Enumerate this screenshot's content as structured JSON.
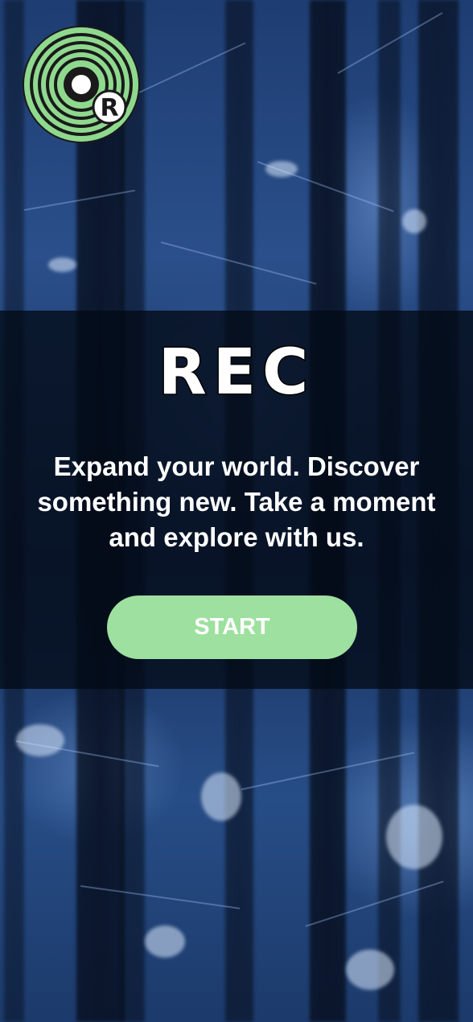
{
  "app": {
    "logo_icon": "vinyl-record-r-logo-icon",
    "logo_letter": "R",
    "title": "REC"
  },
  "main": {
    "tagline": "Expand your world. Discover something new. Take a moment and explore with us.",
    "start_label": "START"
  },
  "colors": {
    "accent": "#9ee09f",
    "band": "#030a16",
    "logo_green": "#8fd98f"
  }
}
